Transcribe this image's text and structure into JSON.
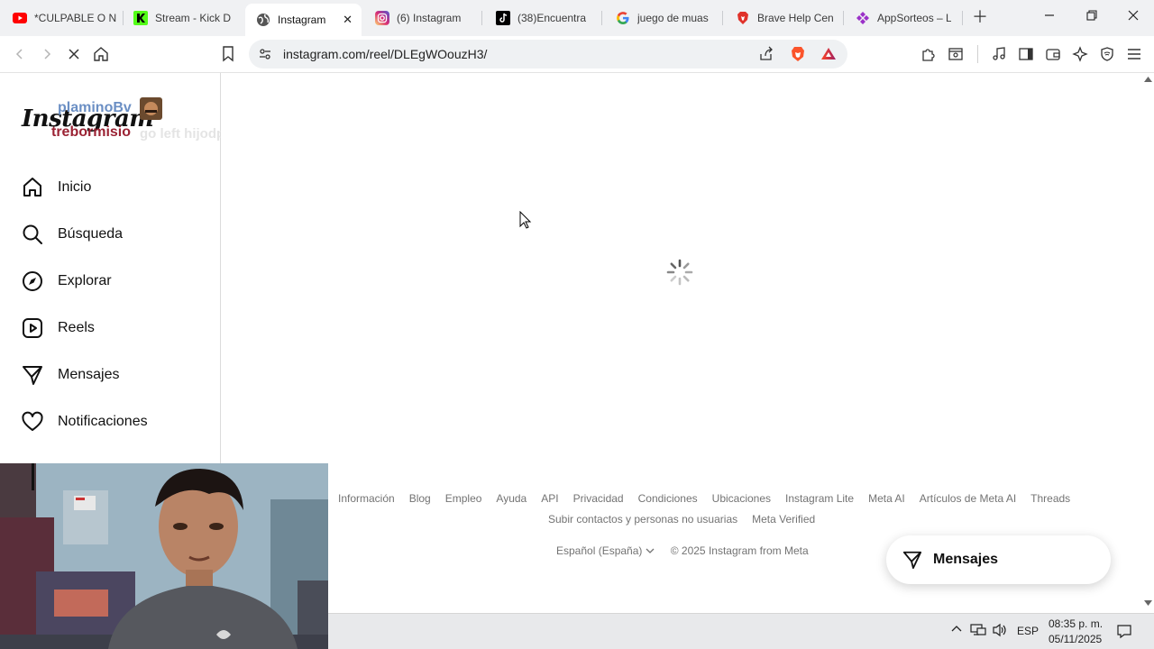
{
  "tabs": [
    {
      "title": "*CULPABLE O N",
      "icon": "youtube-icon",
      "color": "#ff0000"
    },
    {
      "title": "Stream - Kick D",
      "icon": "kick-icon",
      "color": "#53fc18"
    },
    {
      "title": "Instagram",
      "icon": "globe-icon",
      "active": true
    },
    {
      "title": "(6) Instagram",
      "icon": "instagram-icon",
      "color": "#d62976"
    },
    {
      "title": "(38)Encuentra",
      "icon": "tiktok-icon",
      "color": "#000000"
    },
    {
      "title": "juego de muas",
      "icon": "google-icon"
    },
    {
      "title": "Brave Help Cen",
      "icon": "brave-icon",
      "color": "#e0322a"
    },
    {
      "title": "AppSorteos – L",
      "icon": "appsorteos-icon",
      "color": "#9b30c8"
    }
  ],
  "address": {
    "url": "instagram.com/reel/DLEgWOouzH3/"
  },
  "logo": "Instagram",
  "overlay": {
    "user1": "plaminoBv",
    "user2": "trebormisio",
    "message": "go left hijodperra"
  },
  "nav": [
    {
      "label": "Inicio",
      "icon": "home-icon"
    },
    {
      "label": "Búsqueda",
      "icon": "search-icon"
    },
    {
      "label": "Explorar",
      "icon": "compass-icon"
    },
    {
      "label": "Reels",
      "icon": "reels-icon"
    },
    {
      "label": "Mensajes",
      "icon": "send-icon"
    },
    {
      "label": "Notificaciones",
      "icon": "heart-icon"
    }
  ],
  "footer": {
    "row1": [
      "Información",
      "Blog",
      "Empleo",
      "Ayuda",
      "API",
      "Privacidad",
      "Condiciones",
      "Ubicaciones",
      "Instagram Lite",
      "Meta AI",
      "Artículos de Meta AI",
      "Threads"
    ],
    "row2": [
      "Subir contactos y personas no usuarias",
      "Meta Verified"
    ],
    "language": "Español (España)",
    "copyright": "© 2025 Instagram from Meta"
  },
  "messages_button": "Mensajes",
  "taskbar": {
    "lang": "ESP",
    "time": "08:35 p. m.",
    "date": "05/11/2025"
  },
  "colors": {
    "brave": "#fb542b",
    "link_grey": "#737373",
    "sidebar_border": "#dbdbdb"
  }
}
